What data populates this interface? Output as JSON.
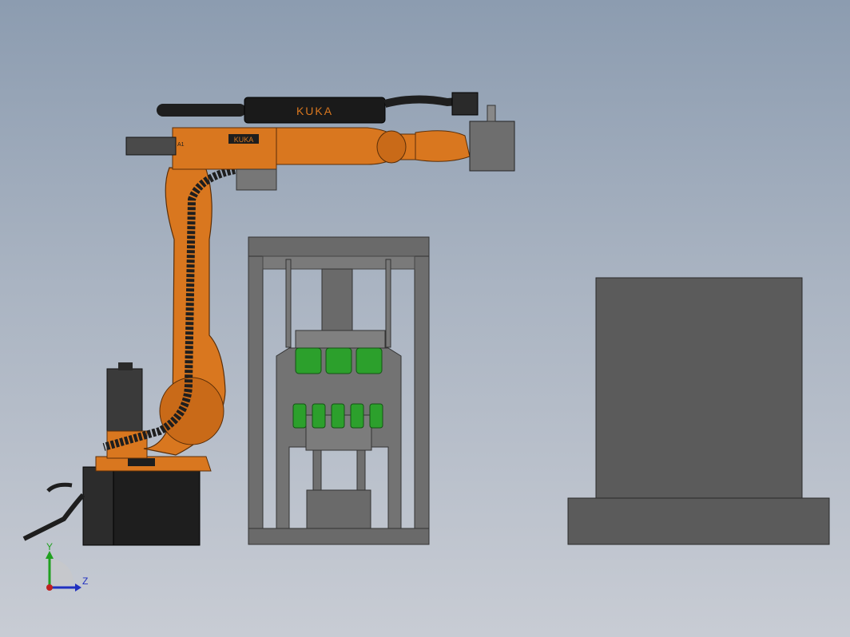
{
  "robot": {
    "brand_label": "KUKA",
    "arm_label": "KUKA",
    "base_label": "A1"
  },
  "triad": {
    "y_label": "Y",
    "z_label": "Z"
  },
  "colors": {
    "background_top": "#8c9cb0",
    "background_bottom": "#c8ccd4",
    "robot_orange": "#d9771f",
    "robot_black": "#1e1e1e",
    "frame_gray": "#5a5a5a",
    "roller_green": "#2ca02c",
    "block_gray": "#5b5b5b",
    "axis_y": "#20a020",
    "axis_z": "#2030c0",
    "axis_x": "#c02020"
  }
}
